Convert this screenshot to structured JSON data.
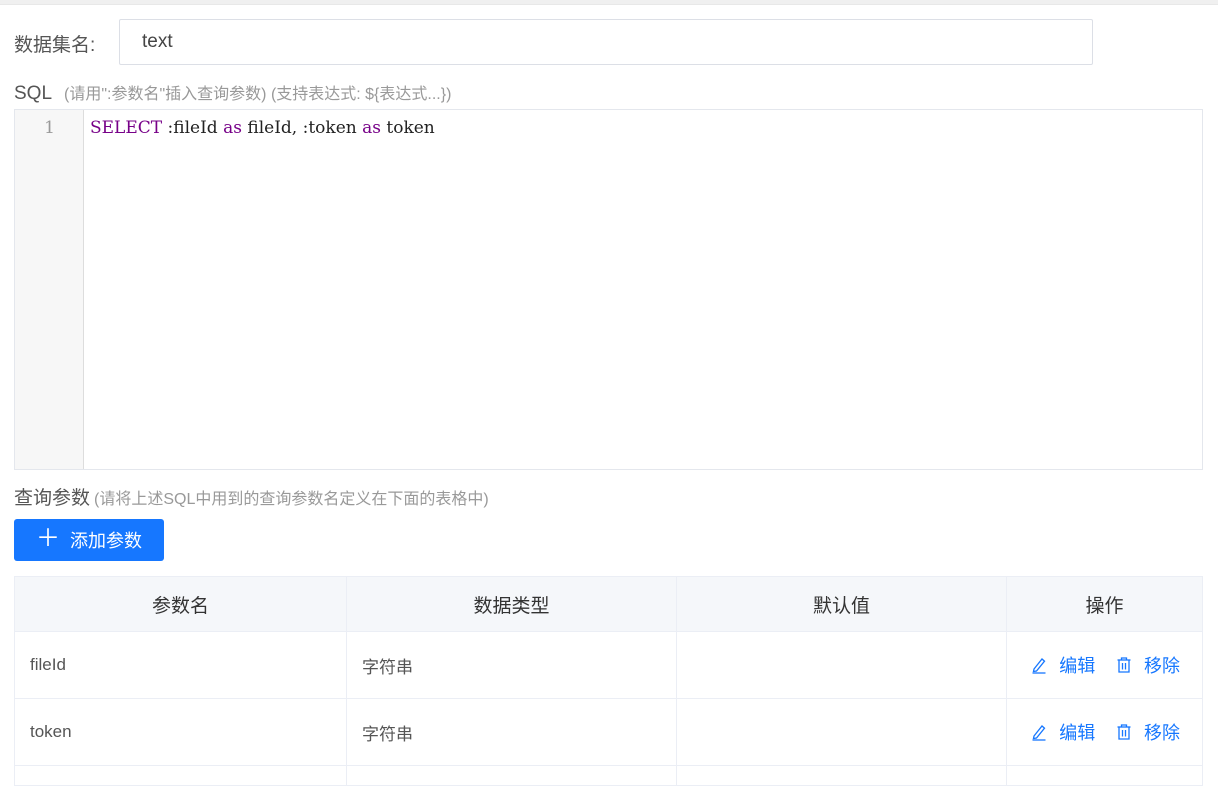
{
  "dataset": {
    "label": "数据集名:",
    "value": "text"
  },
  "sql": {
    "title": "SQL",
    "hint": "(请用\":参数名\"插入查询参数) (支持表达式: ${表达式...})",
    "line_number": "1",
    "tokens": {
      "t1": "SELECT",
      "t2": " :fileId ",
      "t3": "as",
      "t4": " fileId, :token ",
      "t5": "as",
      "t6": " token"
    }
  },
  "params_section": {
    "title": "查询参数",
    "hint": "(请将上述SQL中用到的查询参数名定义在下面的表格中)",
    "add_button": "添加参数"
  },
  "table": {
    "headers": [
      "参数名",
      "数据类型",
      "默认值",
      "操作"
    ],
    "rows": [
      {
        "name": "fileId",
        "type": "字符串",
        "default": "",
        "edit": "编辑",
        "remove": "移除"
      },
      {
        "name": "token",
        "type": "字符串",
        "default": "",
        "edit": "编辑",
        "remove": "移除"
      }
    ]
  },
  "colors": {
    "primary": "#1677ff",
    "keyword": "#770088"
  },
  "icons": {
    "add": "plus-icon",
    "edit": "edit-icon",
    "remove": "trash-icon"
  }
}
